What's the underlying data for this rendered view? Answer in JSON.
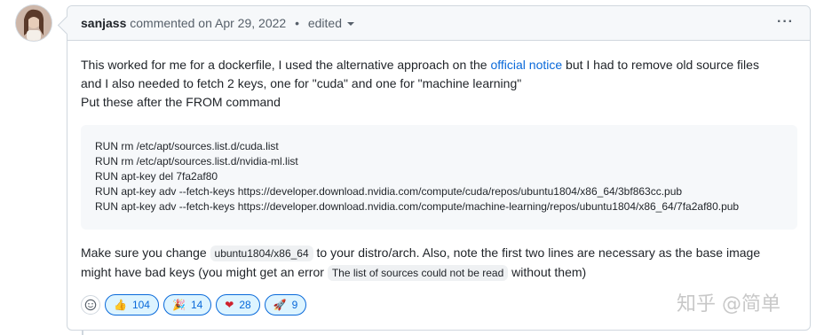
{
  "comment": {
    "author": "sanjass",
    "action": "commented on",
    "date": "Apr 29, 2022",
    "edited_label": "edited",
    "paragraph1_part1": "This worked for me for a dockerfile, I used the alternative approach on the ",
    "paragraph1_link": "official notice",
    "paragraph1_part2": " but I had to remove old source files",
    "paragraph1_line2": "and I also needed to fetch 2 keys, one for \"cuda\" and one for \"machine learning\"",
    "paragraph1_line3": "Put these after the FROM command",
    "code_lines": [
      "RUN rm /etc/apt/sources.list.d/cuda.list",
      "RUN rm /etc/apt/sources.list.d/nvidia-ml.list",
      "RUN apt-key del 7fa2af80",
      "RUN apt-key adv --fetch-keys https://developer.download.nvidia.com/compute/cuda/repos/ubuntu1804/x86_64/3bf863cc.pub",
      "RUN apt-key adv --fetch-keys https://developer.download.nvidia.com/compute/machine-learning/repos/ubuntu1804/x86_64/7fa2af80.pub"
    ],
    "paragraph2_part1": "Make sure you change ",
    "paragraph2_code": "ubuntu1804/x86_64",
    "paragraph2_part2": " to your distro/arch. Also, note the first two lines are necessary as the base image",
    "paragraph2_line2_part1": "might have bad keys (you might get an error ",
    "paragraph2_code2": "The list of sources could not be read",
    "paragraph2_line2_part2": " without them)"
  },
  "reactions": [
    {
      "icon": "thumbs-up-icon",
      "glyph": "👍",
      "count": "104"
    },
    {
      "icon": "tada-icon",
      "glyph": "🎉",
      "count": "14"
    },
    {
      "icon": "heart-icon",
      "glyph": "❤",
      "count": "28"
    },
    {
      "icon": "rocket-icon",
      "glyph": "🚀",
      "count": "9"
    }
  ],
  "watermark": "知乎 @简单",
  "colors": {
    "link": "#0969da",
    "reaction_bg": "#ddf4ff"
  }
}
